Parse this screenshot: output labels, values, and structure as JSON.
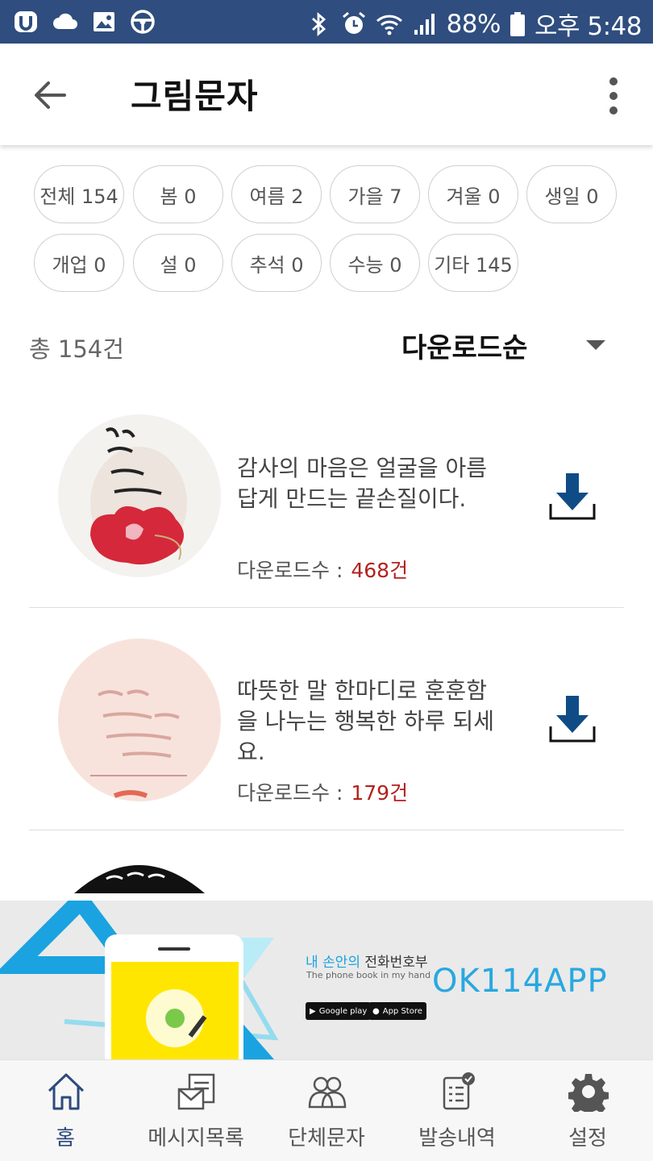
{
  "status_bar": {
    "battery": "88%",
    "time": "오후 5:48"
  },
  "header": {
    "title": "그림문자"
  },
  "chips": [
    "전체 154",
    "봄 0",
    "여름 2",
    "가을 7",
    "겨울 0",
    "생일 0",
    "개업 0",
    "설 0",
    "추석 0",
    "수능 0",
    "기타 145"
  ],
  "summary": {
    "total": "총 154건",
    "sort": "다운로드순"
  },
  "items": [
    {
      "title": "감사의 마음은 얼굴을 아름답게 만드는 끝손질이다.",
      "count_label": "다운로드수 :",
      "count": "468건"
    },
    {
      "title": "따뜻한 말 한마디로 훈훈함을 나누는 행복한 하루 되세요.",
      "count_label": "다운로드수 :",
      "count": "179건"
    }
  ],
  "banner": {
    "headline_accent": "내 손안의",
    "headline": "전화번호부",
    "sub": "The phone book in my hand",
    "brand": "OK114APP",
    "google_play": "Google play",
    "app_store": "App Store"
  },
  "nav": [
    {
      "label": "홈",
      "icon": "home-icon"
    },
    {
      "label": "메시지목록",
      "icon": "message-list-icon"
    },
    {
      "label": "단체문자",
      "icon": "group-icon"
    },
    {
      "label": "발송내역",
      "icon": "history-icon"
    },
    {
      "label": "설정",
      "icon": "gear-icon"
    }
  ],
  "colors": {
    "status_bar": "#2f4d7e",
    "accent": "#2e4a7d",
    "count": "#b3221e",
    "download": "#0f4c86"
  }
}
